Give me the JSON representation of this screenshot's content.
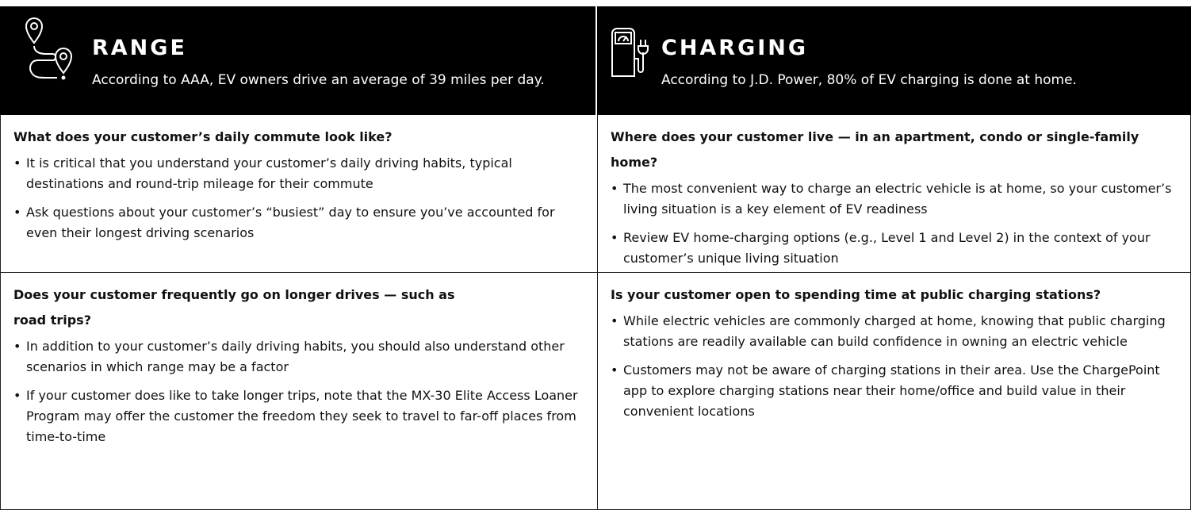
{
  "range": {
    "title": "RANGE",
    "subtitle": "According to AAA, EV owners drive an average of 39 miles per day.",
    "icon": "map-route-icon"
  },
  "charging": {
    "title": "CHARGING",
    "subtitle": "According to J.D. Power, 80% of EV charging is done at home.",
    "icon": "charging-station-icon"
  },
  "bullet": "•",
  "rows": [
    {
      "left": {
        "question": "What does your customer’s daily commute look like?",
        "bullets": [
          "It is critical that you understand your customer’s daily driving habits, typical destinations and round-trip mileage for their commute",
          "Ask questions about your customer’s “busiest” day to ensure you’ve accounted for even their longest driving scenarios"
        ]
      },
      "right": {
        "question": "Where does your customer live — in an apartment, condo or single-family home?",
        "bullets": [
          "The most convenient way to charge an electric vehicle is at home, so your customer’s living situation is a key element of EV readiness",
          "Review EV home-charging options (e.g., Level 1 and Level 2) in the context of your customer’s unique living situation"
        ]
      }
    },
    {
      "left": {
        "question": "Does your customer frequently go on longer drives — such as road trips?",
        "bullets": [
          "In addition to your customer’s daily driving habits, you should also understand other scenarios in which range may be a factor",
          "If your customer does like to take longer trips, note that the MX-30 Elite Access Loaner Program may offer the customer the freedom they seek to travel to far-off places from time-to-time"
        ]
      },
      "right": {
        "question": "Is your customer open to spending time at public charging stations?",
        "bullets": [
          "While electric vehicles are commonly charged at home, knowing that public charging stations are readily available can build confidence in owning an electric vehicle",
          "Customers may not be aware of charging stations in their area. Use the ChargePoint app to explore charging stations near their home/office and build value in their convenient locations"
        ]
      }
    }
  ]
}
